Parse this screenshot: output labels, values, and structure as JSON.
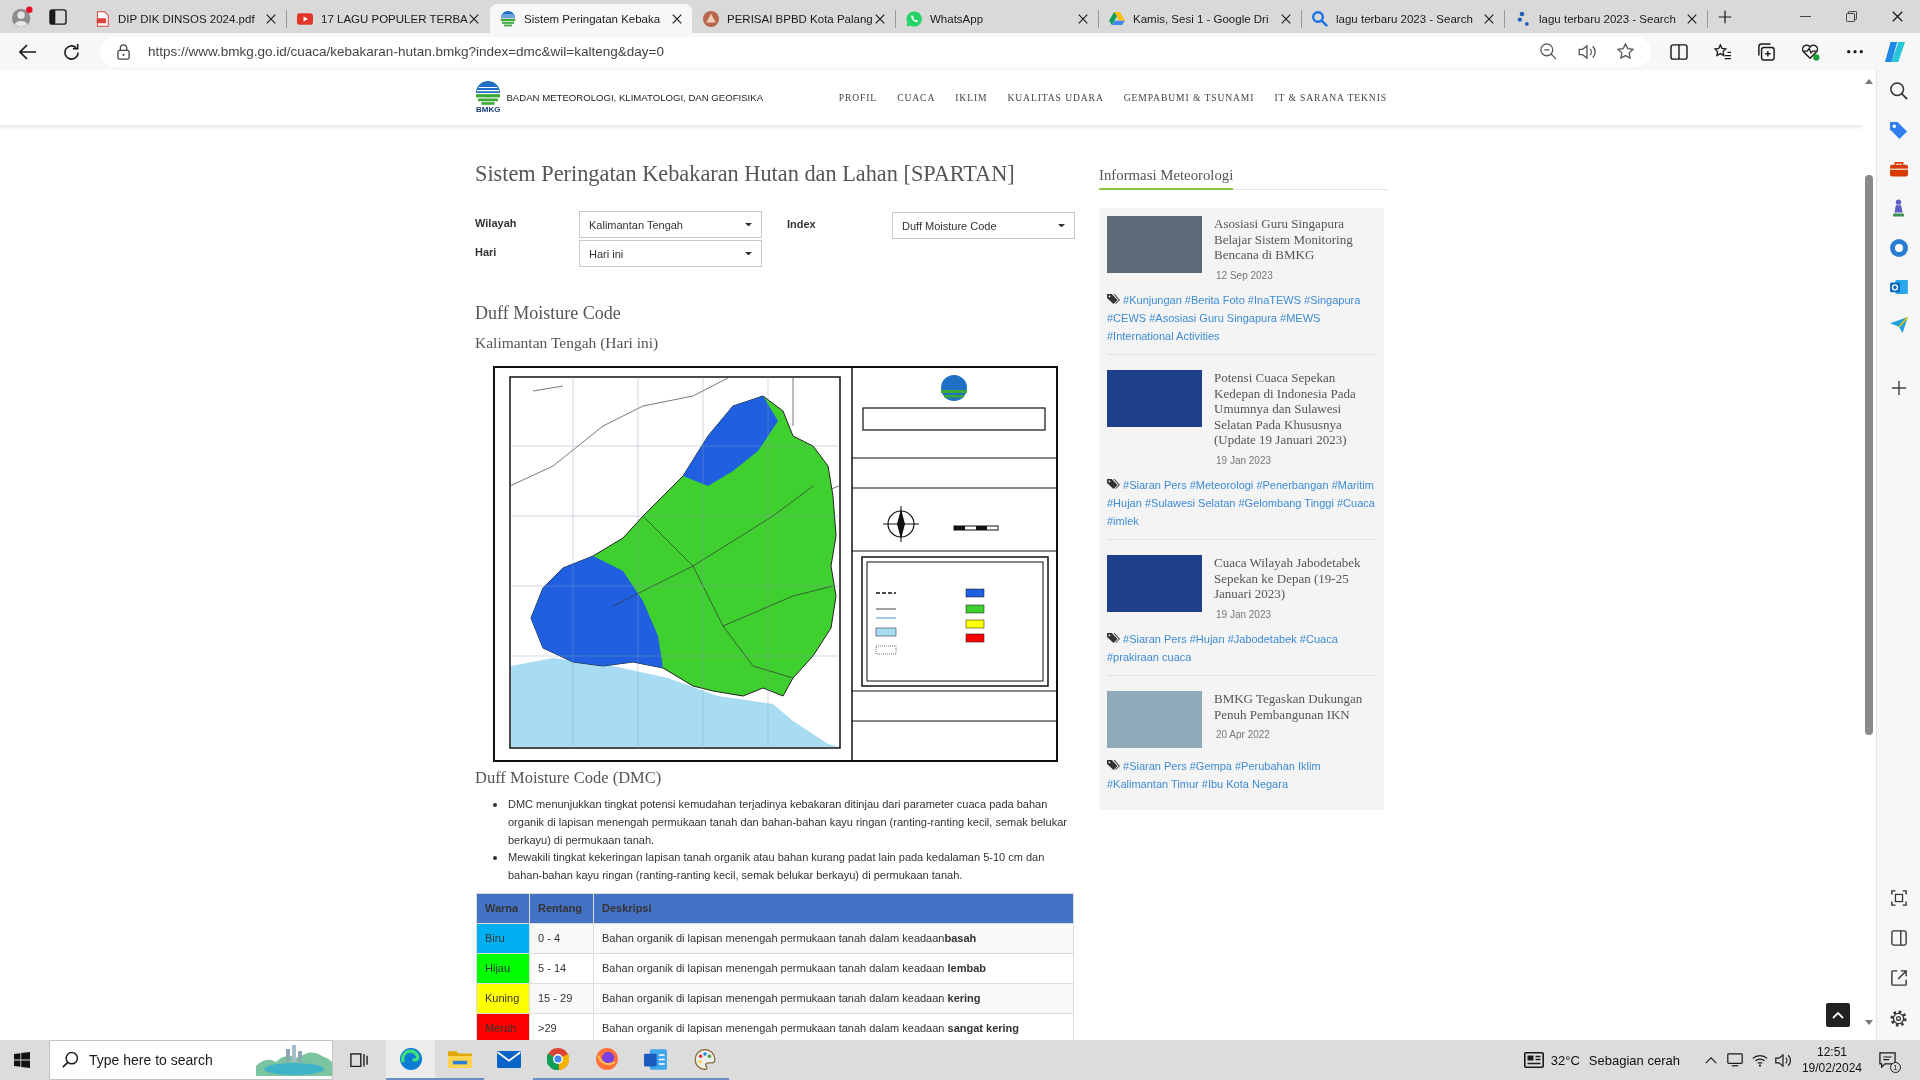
{
  "browser": {
    "tabs": [
      {
        "kind": "pdf",
        "title": "DIP DIK DINSOS 2024.pdf",
        "selected": false
      },
      {
        "kind": "video",
        "title": "17 LAGU POPULER TERBA",
        "selected": false
      },
      {
        "kind": "site",
        "title": "Sistem Peringatan Kebaka",
        "selected": true
      },
      {
        "kind": "shield",
        "title": "PERISAI BPBD Kota Palang",
        "selected": false
      },
      {
        "kind": "chat",
        "title": "WhatsApp",
        "selected": false
      },
      {
        "kind": "drive",
        "title": "Kamis, Sesi 1 - Google Dri",
        "selected": false
      },
      {
        "kind": "search",
        "title": "lagu terbaru 2023 - Search",
        "selected": false
      },
      {
        "kind": "dots",
        "title": "lagu terbaru 2023 - Search",
        "selected": false
      }
    ],
    "address": "https://www.bmkg.go.id/cuaca/kebakaran-hutan.bmkg?index=dmc&wil=kalteng&day=0"
  },
  "site_header": {
    "logo_text": "BMKG",
    "name": "BADAN METEOROLOGI, KLIMATOLOGI, DAN GEOFISIKA",
    "nav": [
      "PROFIL",
      "CUACA",
      "IKLIM",
      "KUALITAS UDARA",
      "GEMPABUMI & TSUNAMI",
      "IT & SARANA TEKNIS"
    ]
  },
  "content": {
    "title": "Sistem Peringatan Kebakaran Hutan dan Lahan [SPARTAN]",
    "filters": [
      {
        "label": "Wilayah",
        "value": "Kalimantan Tengah"
      },
      {
        "label": "Index",
        "value": "Duff Moisture Code"
      },
      {
        "label": "Hari",
        "value": "Hari ini"
      }
    ],
    "heading": "Duff Moisture Code",
    "subheading": "Kalimantan Tengah (Hari ini)",
    "section_title": "Duff Moisture Code (DMC)",
    "bullets": [
      "DMC menunjukkan tingkat potensi kemudahan terjadinya kebakaran ditinjau dari parameter cuaca pada bahan organik di lapisan menengah permukaan tanah dan bahan-bahan kayu ringan (ranting-ranting kecil, semak belukar berkayu) di permukaan tanah.",
      "Mewakili tingkat kekeringan lapisan tanah organik atau bahan kurang padat lain pada kedalaman 5-10 cm dan bahan-bahan kayu ringan (ranting-ranting kecil, semak belukar berkayu) di permukaan tanah."
    ],
    "table": {
      "columns": [
        "Warna",
        "Rentang",
        "Deskripsi"
      ],
      "rows": [
        {
          "color": "#00b0f0",
          "name": "Biru",
          "range": "0 - 4",
          "description": "Bahan organik di lapisan menengah permukaan tanah dalam keadaan**basah**"
        },
        {
          "color": "#00ff00",
          "name": "Hijau",
          "range": "5 - 14",
          "description": "Bahan organik di lapisan menengah permukaan tanah dalam keadaan **lembab**"
        },
        {
          "color": "#ffff00",
          "name": "Kuning",
          "range": "15 - 29",
          "description": "Bahan organik di lapisan menengah permukaan tanah dalam keadaan **kering**"
        },
        {
          "color": "#ff0000",
          "name": "Merah",
          "range": ">29",
          "description": "Bahan organik di lapisan menengah permukaan tanah dalam keadaan **sangat kering**"
        }
      ]
    }
  },
  "sidebar": {
    "title": "Informasi Meteorologi",
    "posts": [
      {
        "title": "Asosiasi Guru Singapura Belajar Sistem Monitoring Bencana di BMKG",
        "date": "12 Sep 2023",
        "tags": [
          "#Kunjungan",
          "#Berita Foto",
          "#InaTEWS",
          "#Singapura",
          "#CEWS",
          "#Asosiasi Guru Singapura",
          "#MEWS",
          "#International Activities"
        ]
      },
      {
        "title": "Potensi Cuaca Sepekan Kedepan di Indonesia Pada Umumnya dan Sulawesi Selatan Pada Khususnya (Update 19 Januari 2023)",
        "date": "19 Jan 2023",
        "tags": [
          "#Siaran Pers",
          "#Meteorologi",
          "#Penerbangan",
          "#Maritim",
          "#Hujan",
          "#Sulawesi Selatan",
          "#Gelombang Tinggi",
          "#Cuaca",
          "#imlek"
        ]
      },
      {
        "title": "Cuaca Wilayah Jabodetabek Sepekan ke Depan (19-25 Januari 2023)",
        "date": "19 Jan 2023",
        "tags": [
          "#Siaran Pers",
          "#Hujan",
          "#Jabodetabek",
          "#Cuaca",
          "#prakiraan cuaca"
        ]
      },
      {
        "title": "BMKG Tegaskan Dukungan Penuh Pembangunan IKN",
        "date": "20 Apr 2022",
        "tags": [
          "#Siaran Pers",
          "#Gempa",
          "#Perubahan Iklim",
          "#Kalimantan Timur",
          "#Ibu Kota Negara"
        ]
      }
    ]
  },
  "taskbar": {
    "search_placeholder": "Type here to search",
    "apps": [
      {
        "kind": "browser",
        "running": true,
        "selected": true
      },
      {
        "kind": "folder",
        "running": true,
        "selected": false
      },
      {
        "kind": "mail",
        "running": false,
        "selected": false
      },
      {
        "kind": "chrome",
        "running": true,
        "selected": false
      },
      {
        "kind": "firefox",
        "running": true,
        "selected": false
      },
      {
        "kind": "word",
        "running": true,
        "selected": false
      },
      {
        "kind": "paint",
        "running": true,
        "selected": false
      }
    ],
    "weather": {
      "temperature": "32°C",
      "condition": "Sebagian cerah"
    },
    "time": "12:51",
    "date": "19/02/2024",
    "notification_count": "1"
  }
}
